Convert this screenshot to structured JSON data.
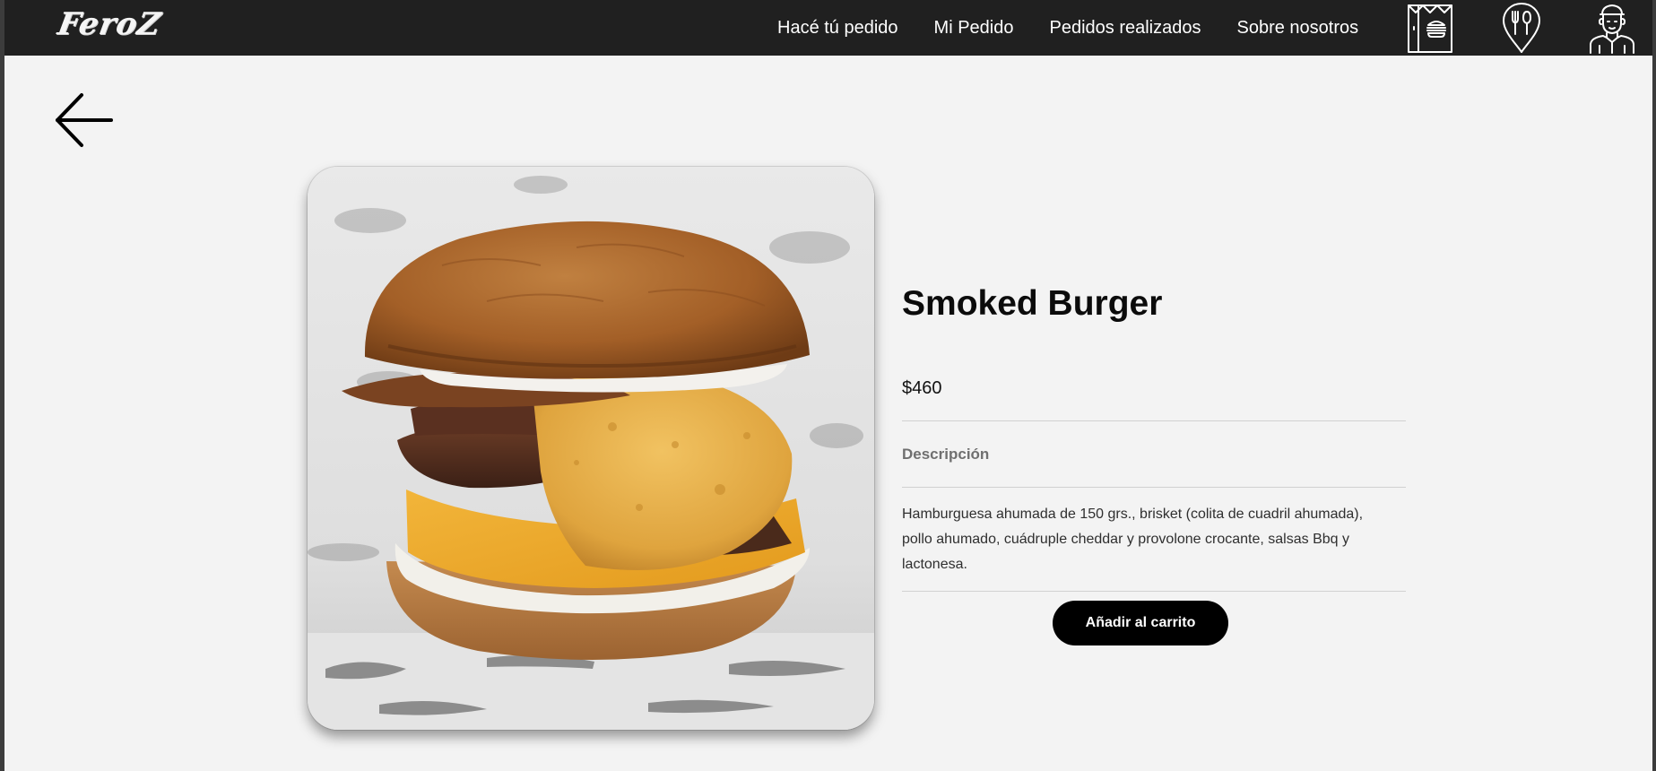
{
  "navbar": {
    "logo_text": "FeroZ",
    "links": [
      {
        "label": "Hacé tú pedido"
      },
      {
        "label": "Mi Pedido"
      },
      {
        "label": "Pedidos realizados"
      },
      {
        "label": "Sobre nosotros"
      }
    ],
    "icons": [
      {
        "name": "takeaway-bag-icon"
      },
      {
        "name": "location-pin-fork-spoon-icon"
      },
      {
        "name": "chef-avatar-icon"
      }
    ]
  },
  "page": {
    "back_icon": "arrow-left-icon"
  },
  "product": {
    "name": "Smoked Burger",
    "price": "$460",
    "description_label": "Descripción",
    "description": "Hamburguesa ahumada de 150 grs., brisket (colita de cuadril ahumada), pollo ahumado, cuádruple cheddar y provolone crocante, salsas Bbq y lactonesa.",
    "add_to_cart_label": "Añadir al carrito"
  },
  "colors": {
    "navbar_bg": "#202020",
    "page_bg": "#f3f3f3",
    "button_bg": "#000000",
    "text_primary": "#0b0b0b",
    "text_muted": "#6f6f6f"
  }
}
